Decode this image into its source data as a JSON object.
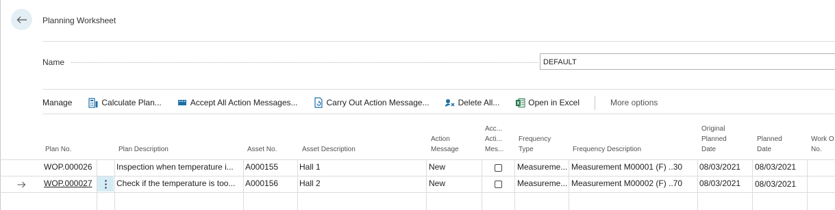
{
  "page": {
    "title": "Planning Worksheet"
  },
  "name_field": {
    "label": "Name",
    "value": "DEFAULT"
  },
  "actionbar": {
    "manage": "Manage",
    "calculate_plan": "Calculate Plan...",
    "accept_all": "Accept All Action Messages...",
    "carry_out": "Carry Out Action Message...",
    "delete_all": "Delete All...",
    "open_excel": "Open in Excel",
    "more_options": "More options"
  },
  "columns": {
    "plan_no": "Plan No.",
    "plan_desc": "Plan Description",
    "asset_no": "Asset No.",
    "asset_desc": "Asset Description",
    "action_message": [
      "Action",
      "Message"
    ],
    "accept_action": [
      "Acc...",
      "Acti...",
      "Mes..."
    ],
    "frequency_type": [
      "Frequency",
      "Type"
    ],
    "frequency_desc": "Frequency Description",
    "original_planned": [
      "Original",
      "Planned",
      "Date"
    ],
    "planned_date": [
      "Planned",
      "Date"
    ],
    "work_order": [
      "Work O",
      "No."
    ]
  },
  "rows": [
    {
      "plan_no": "WOP.000026",
      "plan_desc": "Inspection when temperature i...",
      "asset_no": "A000155",
      "asset_desc": "Hall 1",
      "action_message": "New",
      "accept": false,
      "frequency_type": "Measureme...",
      "frequency_desc": "Measurement M00001 (F) ..30",
      "original_planned": "08/03/2021",
      "planned_date": "08/03/2021",
      "work_order": ""
    },
    {
      "plan_no": "WOP.000027",
      "plan_desc": "Check if the temperature is too...",
      "asset_no": "A000156",
      "asset_desc": "Hall 2",
      "action_message": "New",
      "accept": false,
      "frequency_type": "Measureme...",
      "frequency_desc": "Measurement M00002 (F) ..70",
      "original_planned": "08/03/2021",
      "planned_date": "08/03/2021",
      "work_order": ""
    }
  ],
  "colors": {
    "accent": "#00a0e6",
    "selected_cell": "#d4ecf5",
    "back_button_bg": "#e3eef5",
    "excel_green": "#1e7145"
  },
  "icons": {
    "back": "arrow-left-icon",
    "calculate": "calculate-plan-icon",
    "accept": "accept-messages-icon",
    "carry_out": "carry-out-icon",
    "delete": "delete-all-icon",
    "excel": "excel-icon",
    "row_marker": "arrow-right-icon",
    "row_menu": "kebab-menu-icon"
  }
}
